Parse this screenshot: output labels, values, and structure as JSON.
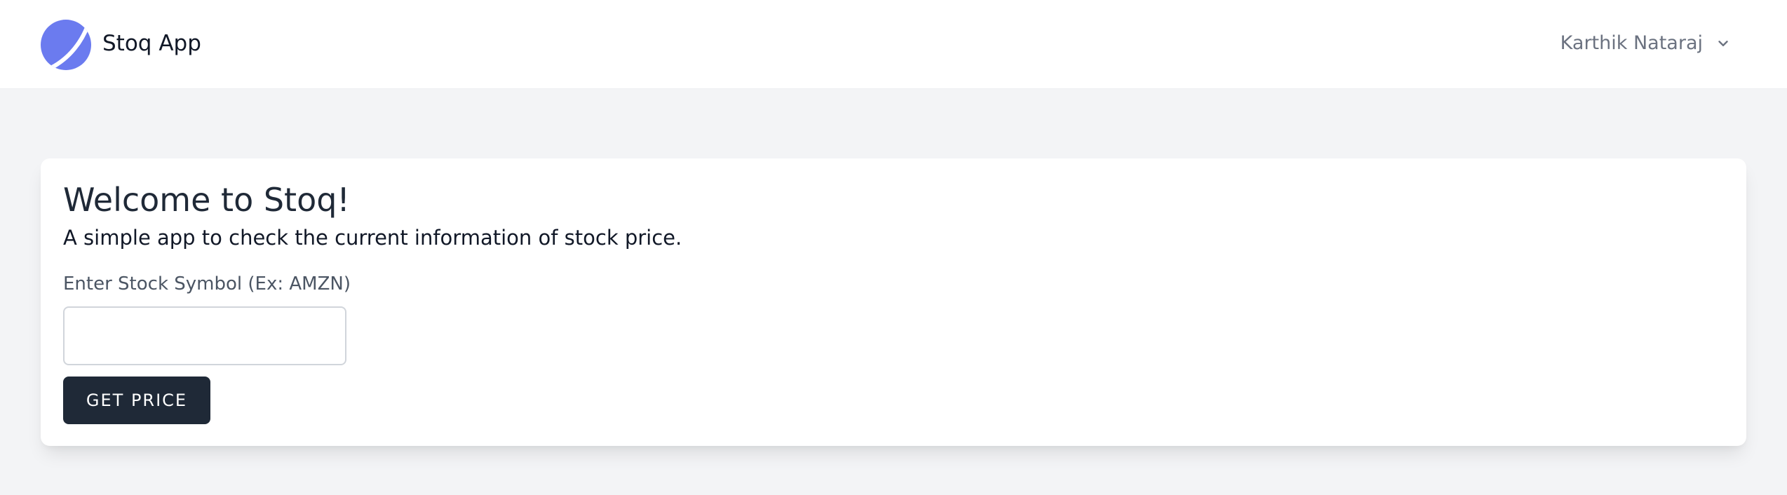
{
  "navbar": {
    "brand": "Stoq App",
    "user_name": "Karthik Nataraj",
    "logo_icon": "crescent-logo-icon",
    "chevron_icon": "chevron-down-icon",
    "accent_color": "#6b7bef"
  },
  "welcome": {
    "title": "Welcome to Stoq!",
    "subtitle": "A simple app to check the current information of stock price.",
    "input_label": "Enter Stock Symbol (Ex: AMZN)",
    "input_value": "",
    "button_label": "GET PRICE",
    "button_color": "#1f2937"
  }
}
